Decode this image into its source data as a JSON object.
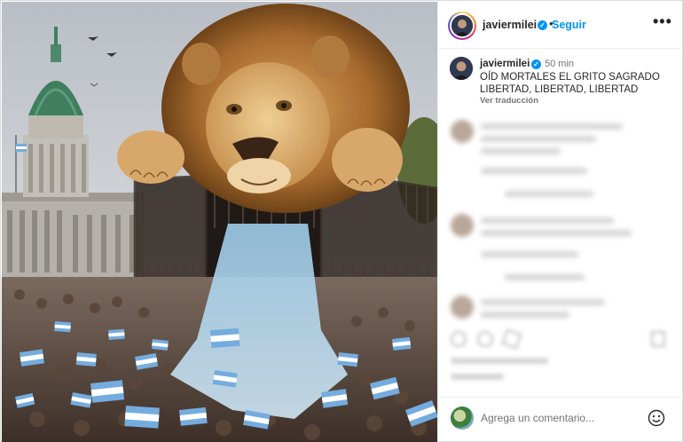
{
  "post": {
    "username": "javiermilei",
    "follow_label": "Seguir",
    "separator": "•",
    "more_label": "•••"
  },
  "caption": {
    "username": "javiermilei",
    "time": "50 min",
    "text": "OÍD MORTALES EL GRITO SAGRADO LIBERTAD, LIBERTAD, LIBERTAD",
    "translate_label": "Ver traducción"
  },
  "comment_box": {
    "placeholder": "Agrega un comentario..."
  },
  "icons": {
    "verified": "verified-badge-icon",
    "more": "more-options-icon",
    "emoji": "emoji-icon"
  },
  "colors": {
    "link_blue": "#0095f6",
    "text": "#262626",
    "muted": "#737373",
    "border": "#efefef"
  }
}
